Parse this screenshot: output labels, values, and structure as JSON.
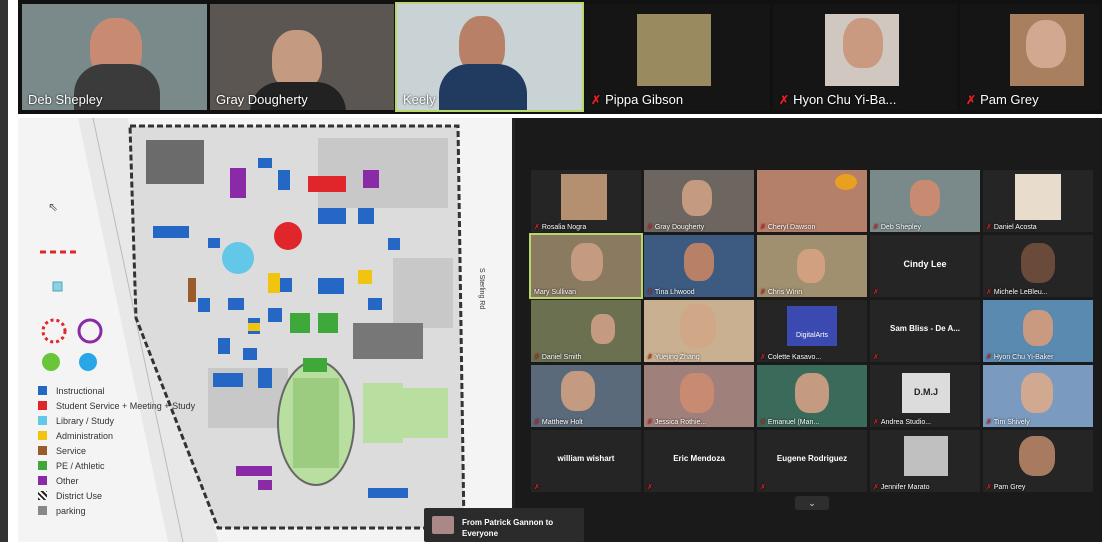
{
  "top_strip": {
    "participants": [
      {
        "name": "Deb Shepley",
        "muted": false
      },
      {
        "name": "Gray Dougherty",
        "muted": false
      },
      {
        "name": "Keely",
        "muted": false
      },
      {
        "name": "Pippa Gibson",
        "muted": true
      },
      {
        "name": "Hyon Chu Yi-Ba...",
        "muted": true
      },
      {
        "name": "Pam Grey",
        "muted": true
      }
    ]
  },
  "map": {
    "legend": [
      {
        "label": "Instructional",
        "color": "#2467c4"
      },
      {
        "label": "Student Service + Meeting + Study",
        "color": "#e0262b"
      },
      {
        "label": "Library / Study",
        "color": "#63c7e8"
      },
      {
        "label": "Administration",
        "color": "#f1c40f"
      },
      {
        "label": "Service",
        "color": "#9a5a2a"
      },
      {
        "label": "PE / Athletic",
        "color": "#3fa83a"
      },
      {
        "label": "Other",
        "color": "#8b2aa6"
      },
      {
        "label": "District Use",
        "color": "#222222"
      },
      {
        "label": "parking",
        "color": "#888888"
      }
    ],
    "road_label": "S Sterling Rd"
  },
  "gallery": {
    "rows": [
      [
        "Rosalia Nogra",
        "Gray Dougherty",
        "Cheryl Dawson",
        "Deb Shepley",
        "Daniel Acosta"
      ],
      [
        "Mary Sullivan",
        "Tina Lhwood",
        "Chris Winn",
        "Cindy Lee",
        "Michele LeBleu..."
      ],
      [
        "Daniel Smith",
        "Yuejing Zhang",
        "Colette Kasavo...",
        "Sam Bliss - De A...",
        "Hyon Chu Yi-Baker"
      ],
      [
        "Matthew Holt",
        "Jessica Rothie...",
        "Emanuel (Man...",
        "Andrea Studio...",
        "Tim Shively"
      ],
      [
        "william wishart",
        "Eric Mendoza",
        "Eugene Rodriguez",
        "Jennifer Marato",
        "Pam Grey"
      ]
    ],
    "text_only": [
      "Cindy Lee",
      "Sam Bliss - De A...",
      "william wishart",
      "Eric Mendoza",
      "Eugene Rodriguez"
    ],
    "digital_arts_logo": "DigitalArts",
    "andrea_logo": "D.M.J"
  },
  "chat_notice": {
    "line1": "From Patrick Gannon to",
    "line2": "Everyone"
  },
  "chevron": "⌄"
}
